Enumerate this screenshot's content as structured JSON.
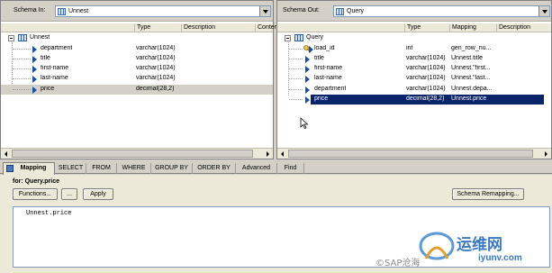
{
  "left_panel": {
    "schema_label": "Schema In:",
    "schema_value": "Unnest",
    "columns": [
      "Type",
      "Description",
      "Conter"
    ],
    "root": "Unnest",
    "fields": [
      {
        "name": "department",
        "type": "varchar(1024)"
      },
      {
        "name": "title",
        "type": "varchar(1024)"
      },
      {
        "name": "first-name",
        "type": "varchar(1024)"
      },
      {
        "name": "last-name",
        "type": "varchar(1024)"
      },
      {
        "name": "price",
        "type": "decimal(28,2)"
      }
    ]
  },
  "right_panel": {
    "schema_label": "Schema Out:",
    "schema_value": "Query",
    "columns": [
      "Type",
      "Mapping",
      "Description"
    ],
    "root": "Query",
    "fields": [
      {
        "name": "load_id",
        "type": "int",
        "mapping": "gen_row_nu..."
      },
      {
        "name": "title",
        "type": "varchar(1024)",
        "mapping": "Unnest.title"
      },
      {
        "name": "first-name",
        "type": "varchar(1024)",
        "mapping": "Unnest.\"first..."
      },
      {
        "name": "last-name",
        "type": "varchar(1024)",
        "mapping": "Unnest.\"last..."
      },
      {
        "name": "department",
        "type": "varchar(1024)",
        "mapping": "Unnest.depa..."
      },
      {
        "name": "price",
        "type": "decimal(28,2)",
        "mapping": "Unnest.price"
      }
    ]
  },
  "tabs": [
    "Mapping",
    "SELECT",
    "FROM",
    "WHERE",
    "GROUP BY",
    "ORDER BY",
    "Advanced",
    "Find"
  ],
  "mapping": {
    "for_label": "for: Query.price",
    "functions_button": "Functions...",
    "ellipsis_button": "...",
    "apply_button": "Apply",
    "schema_remapping_button": "Schema Remapping...",
    "expression": "Unnest.price"
  },
  "watermark": {
    "cn": "运维网",
    "url": "iyunv.com",
    "sap": "©SAP沧海"
  }
}
